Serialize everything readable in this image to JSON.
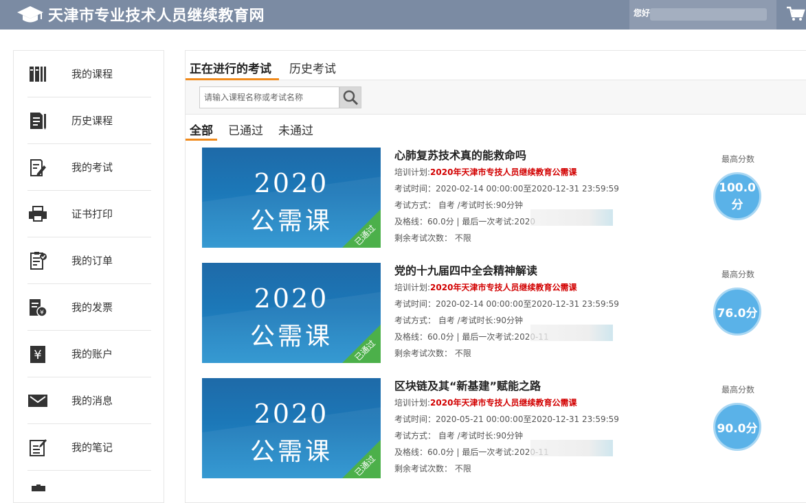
{
  "header": {
    "site_title": "天津市专业技术人员继续教育网",
    "greeting": "您好"
  },
  "sidebar": {
    "items": [
      {
        "label": "我的课程",
        "icon": "books-icon"
      },
      {
        "label": "历史课程",
        "icon": "document-pen-icon"
      },
      {
        "label": "我的考试",
        "icon": "exam-pen-icon"
      },
      {
        "label": "证书打印",
        "icon": "printer-icon"
      },
      {
        "label": "我的订单",
        "icon": "clipboard-check-icon"
      },
      {
        "label": "我的发票",
        "icon": "invoice-icon"
      },
      {
        "label": "我的账户",
        "icon": "yen-account-icon"
      },
      {
        "label": "我的消息",
        "icon": "envelope-icon"
      },
      {
        "label": "我的笔记",
        "icon": "note-edit-icon"
      }
    ]
  },
  "main": {
    "tabs": [
      "正在进行的考试",
      "历史考试"
    ],
    "search": {
      "placeholder": "请输入课程名称或考试名称"
    },
    "filters": [
      "全部",
      "已通过",
      "未通过"
    ],
    "thumb_year": "2020",
    "thumb_subtitle": "公需课",
    "badge": "已通过",
    "score_label": "最高分数",
    "plan_label": "培训计划:",
    "exams": [
      {
        "title": "心肺复苏技术真的能救命吗",
        "plan": "2020年天津市专技人员继续教育公需课",
        "time": "考试时间：2020-02-14 00:00:00至2020-12-31 23:59:59",
        "mode": "考试方式：  自考 /考试时长:90分钟",
        "pass_line": "及格线：60.0分 | 最后一次考试:2020",
        "remaining": "剩余考试次数：  不限",
        "score": "100.0分"
      },
      {
        "title": "党的十九届四中全会精神解读",
        "plan": "2020年天津市专技人员继续教育公需课",
        "time": "考试时间：2020-02-14 00:00:00至2020-12-31 23:59:59",
        "mode": "考试方式：  自考 /考试时长:90分钟",
        "pass_line": "及格线：60.0分 | 最后一次考试:2020-11",
        "remaining": "剩余考试次数：  不限",
        "score": "76.0分"
      },
      {
        "title": "区块链及其“新基建”赋能之路",
        "plan": "2020年天津市专技人员继续教育公需课",
        "time": "考试时间：2020-05-21 00:00:00至2020-12-31 23:59:59",
        "mode": "考试方式：  自考 /考试时长:90分钟",
        "pass_line": "及格线：60.0分 | 最后一次考试:2020-11",
        "remaining": "剩余考试次数：  不限",
        "score": "90.0分"
      }
    ]
  },
  "colors": {
    "header_bg": "#7b8ba3",
    "accent": "#f08a1c",
    "plan_red": "#d20000",
    "score_blue": "#5ab2e8",
    "badge_green": "#4cb04a"
  }
}
